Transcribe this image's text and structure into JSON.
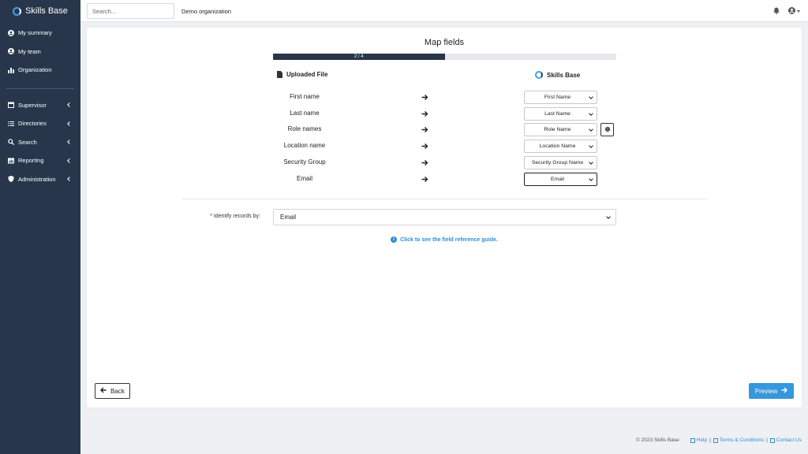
{
  "sidebar": {
    "brand": "Skills Base",
    "items": [
      {
        "label": "My summary"
      },
      {
        "label": "My team"
      },
      {
        "label": "Organization"
      },
      {
        "label": "Supervisor"
      },
      {
        "label": "Directories"
      },
      {
        "label": "Search"
      },
      {
        "label": "Reporting"
      },
      {
        "label": "Administration"
      }
    ]
  },
  "topbar": {
    "search_placeholder": "Search...",
    "org_name": "Demo organization"
  },
  "main": {
    "title": "Map fields",
    "progress": {
      "label": "2 / 4",
      "fraction": 0.5
    },
    "left_header": "Uploaded File",
    "right_header": "Skills Base",
    "rows": [
      {
        "source": "First name",
        "target": "First Name"
      },
      {
        "source": "Last name",
        "target": "Last Name"
      },
      {
        "source": "Role names",
        "target": "Role Name"
      },
      {
        "source": "Location name",
        "target": "Location Name"
      },
      {
        "source": "Security Group",
        "target": "Security Group Name"
      },
      {
        "source": "Email",
        "target": "Email"
      }
    ],
    "identify_label": "* Identify records by:",
    "identify_value": "Email",
    "reference_link": "Click to see the field reference guide.",
    "back_label": "Back",
    "preview_label": "Preview"
  },
  "footer": {
    "copyright": "© 2023 Skills Base",
    "help": "Help",
    "terms": "Terms & Conditions",
    "contact": "Contact Us",
    "separator": "|"
  },
  "colors": {
    "sidebar_bg": "#27364b",
    "accent": "#3597dc",
    "link": "#2e8fd6"
  }
}
